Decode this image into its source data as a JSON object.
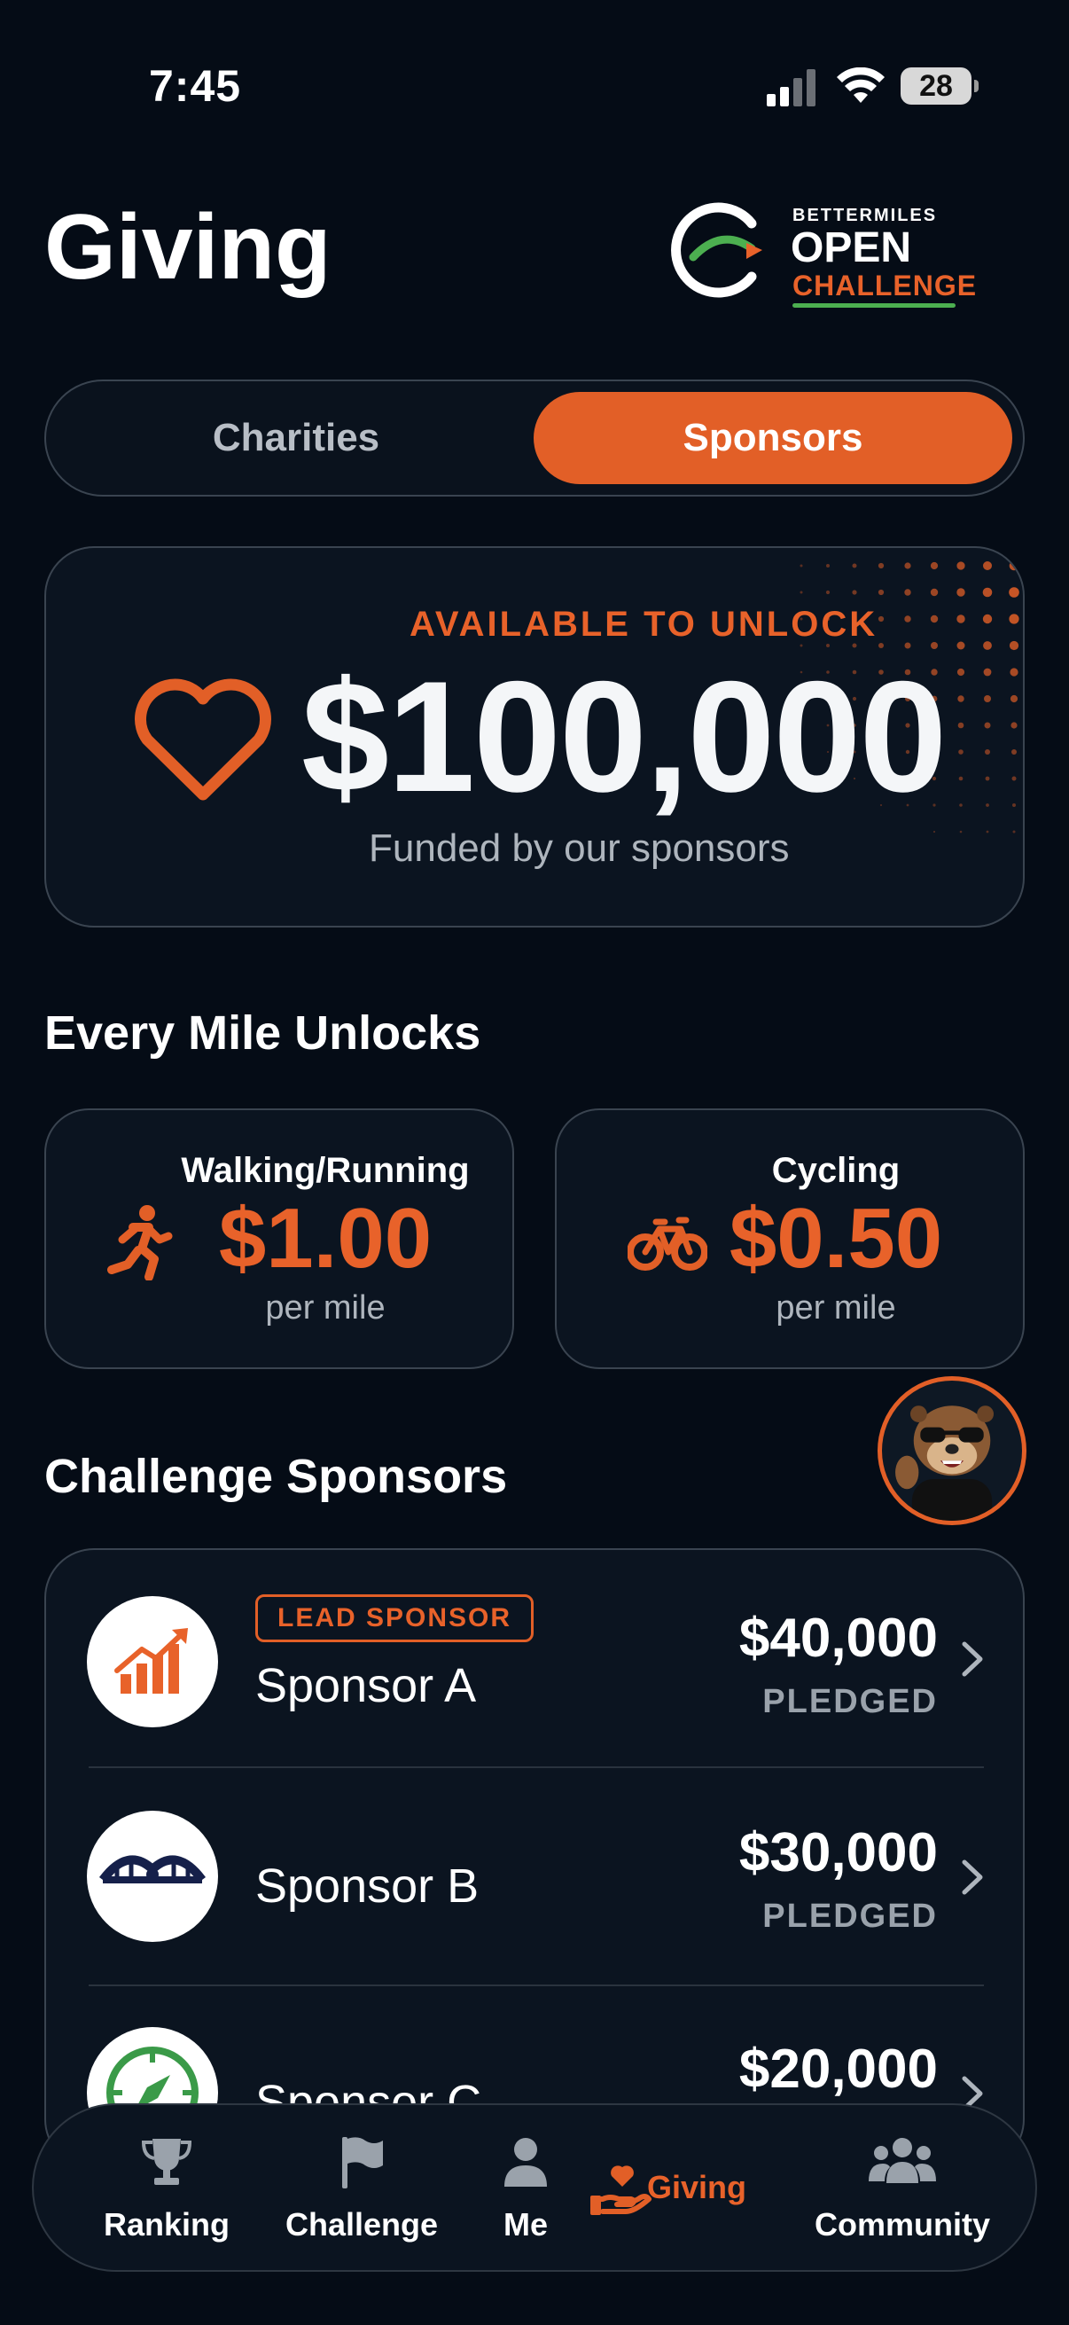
{
  "status_bar": {
    "time": "7:45",
    "battery": "28"
  },
  "header": {
    "title": "Giving",
    "logo": {
      "top": "BETTERMILES",
      "middle": "OPEN",
      "bottom": "CHALLENGE"
    }
  },
  "tabs": [
    {
      "label": "Charities",
      "active": false
    },
    {
      "label": "Sponsors",
      "active": true
    }
  ],
  "hero": {
    "eyebrow": "AVAILABLE TO UNLOCK",
    "amount": "$100,000",
    "subtitle": "Funded by our sponsors",
    "icon": "heart-icon"
  },
  "rates": {
    "title": "Every Mile Unlocks",
    "items": [
      {
        "label": "Walking/Running",
        "value": "$1.00",
        "unit": "per mile",
        "icon": "running-icon"
      },
      {
        "label": "Cycling",
        "value": "$0.50",
        "unit": "per mile",
        "icon": "bicycle-icon"
      }
    ]
  },
  "sponsors": {
    "title": "Challenge Sponsors",
    "items": [
      {
        "badge": "LEAD SPONSOR",
        "name": "Sponsor A",
        "amount": "$40,000",
        "status": "PLEDGED",
        "icon": "growth-chart-icon"
      },
      {
        "name": "Sponsor B",
        "amount": "$30,000",
        "status": "PLEDGED",
        "icon": "bridge-icon"
      },
      {
        "name": "Sponsor C",
        "amount": "$20,000",
        "icon": "compass-icon"
      }
    ]
  },
  "nav": [
    {
      "label": "Ranking",
      "icon": "trophy-icon",
      "active": false
    },
    {
      "label": "Challenge",
      "icon": "flag-icon",
      "active": false
    },
    {
      "label": "Me",
      "icon": "person-icon",
      "active": false
    },
    {
      "label": "Giving",
      "icon": "giving-hand-icon",
      "active": true
    },
    {
      "label": "Community",
      "icon": "group-icon",
      "active": false
    }
  ],
  "colors": {
    "accent": "#e25f27",
    "background": "#050c16",
    "card": "#0b1420",
    "success": "#4caf50"
  }
}
